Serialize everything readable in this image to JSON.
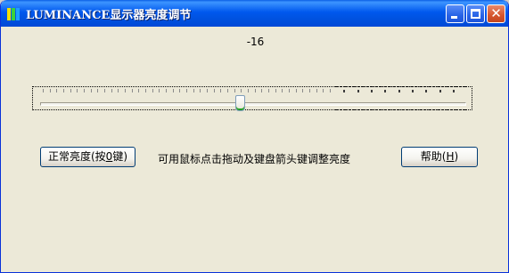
{
  "window": {
    "title": "LUMINANCE显示器亮度调节",
    "app_icon": "luminance-bars-icon",
    "controls": [
      "minimize",
      "maximize",
      "close"
    ]
  },
  "brightness": {
    "value_label": "-16",
    "slider_min": -255,
    "slider_max": 255,
    "slider_value": -16,
    "tick_count": 60
  },
  "buttons": {
    "normal_prefix": "正常亮度(按",
    "normal_mnemonic": "0",
    "normal_suffix": "键)",
    "help_prefix": "帮助(",
    "help_mnemonic": "H",
    "help_suffix": ")"
  },
  "hint": "可用鼠标点击拖动及键盘箭头键调整亮度",
  "colors": {
    "titlebar": "#0058ee",
    "window_bg": "#ece9d8",
    "thumb_accent": "#21a121"
  }
}
